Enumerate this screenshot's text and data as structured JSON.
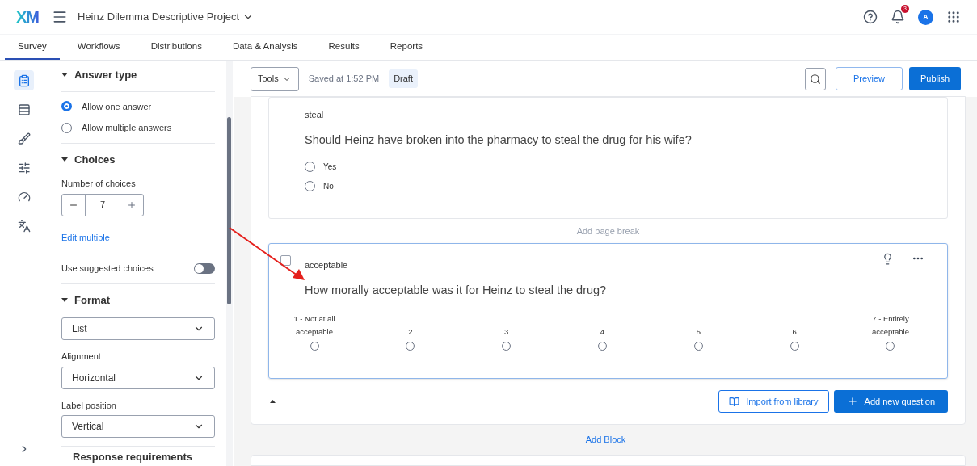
{
  "header": {
    "logo": "XM",
    "project_title": "Heinz Dilemma Descriptive Project",
    "notification_count": "3",
    "avatar_initial": "A"
  },
  "tabs": [
    {
      "label": "Survey",
      "selected": true
    },
    {
      "label": "Workflows",
      "selected": false
    },
    {
      "label": "Distributions",
      "selected": false
    },
    {
      "label": "Data & Analysis",
      "selected": false
    },
    {
      "label": "Results",
      "selected": false
    },
    {
      "label": "Reports",
      "selected": false
    }
  ],
  "rail": [
    {
      "kind": "survey",
      "selected": true
    },
    {
      "kind": "flow",
      "selected": false
    },
    {
      "kind": "look",
      "selected": false
    },
    {
      "kind": "options",
      "selected": false
    },
    {
      "kind": "tools",
      "selected": false
    },
    {
      "kind": "translate",
      "selected": false
    }
  ],
  "panel": {
    "answer_type": {
      "title": "Answer type",
      "options": [
        {
          "label": "Allow one answer",
          "selected": true
        },
        {
          "label": "Allow multiple answers",
          "selected": false
        }
      ]
    },
    "choices": {
      "title": "Choices",
      "count_label": "Number of choices",
      "count": "7",
      "edit_link": "Edit multiple",
      "suggested_label": "Use suggested choices",
      "suggested_on": false
    },
    "format": {
      "title": "Format",
      "value": "List",
      "fields": [
        {
          "label": "Alignment",
          "value": "Horizontal"
        },
        {
          "label": "Label position",
          "value": "Vertical"
        }
      ]
    },
    "next_section": "Response requirements"
  },
  "toolbar": {
    "tools": "Tools",
    "saved": "Saved at 1:52 PM",
    "status": "Draft",
    "preview": "Preview",
    "publish": "Publish"
  },
  "questions": [
    {
      "kind": "multiple_choice",
      "tag": "steal",
      "text": "Should Heinz have broken into the pharmacy to steal the drug for his wife?",
      "selected": false,
      "choices": [
        {
          "label": "Yes",
          "selected": false
        },
        {
          "label": "No",
          "selected": false
        }
      ]
    },
    {
      "kind": "scale",
      "tag": "acceptable",
      "text": "How morally acceptable was it for Heinz to steal the drug?",
      "selected": true,
      "choices": [
        {
          "label": "1 - Not at all acceptable",
          "selected": false
        },
        {
          "label": "2",
          "selected": false
        },
        {
          "label": "3",
          "selected": false
        },
        {
          "label": "4",
          "selected": false
        },
        {
          "label": "5",
          "selected": false
        },
        {
          "label": "6",
          "selected": false
        },
        {
          "label": "7 - Entirely acceptable",
          "selected": false
        }
      ]
    }
  ],
  "page_break": "Add page break",
  "block_actions": {
    "import": "Import from library",
    "add_question": "Add new question"
  },
  "add_block": "Add Block"
}
